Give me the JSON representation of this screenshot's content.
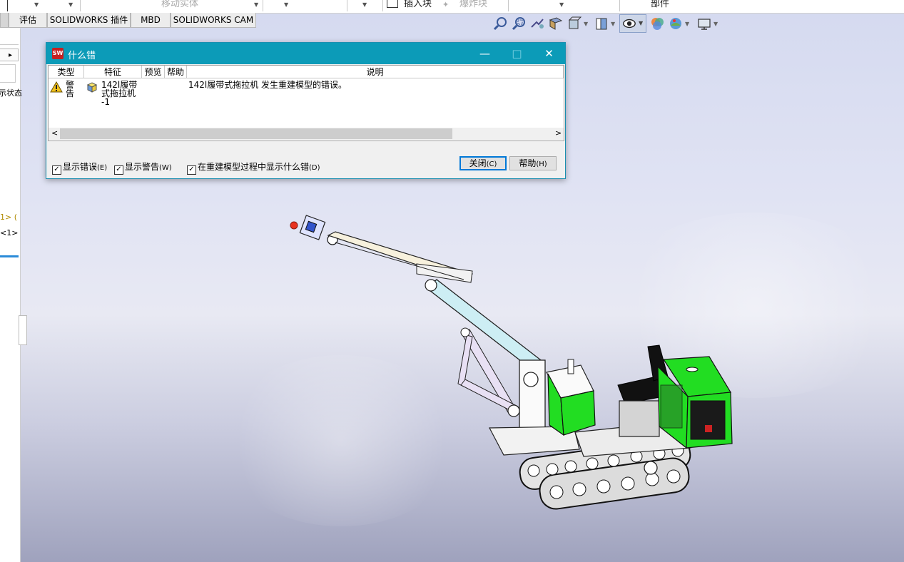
{
  "toolbar": {
    "move_body_label": "移动实体",
    "insert_block_label": "插入块",
    "explode_label": "爆炸块",
    "part_label": "部件"
  },
  "tabs": [
    "评估",
    "SOLIDWORKS 插件",
    "MBD",
    "SOLIDWORKS CAM"
  ],
  "left_panel": {
    "state_text": "示状态",
    "config_text_1": "1> (",
    "config_text_2": "<1>",
    "arrow": "▸"
  },
  "hud_icons": [
    "zoom-to-fit-icon",
    "zoom-area-icon",
    "previous-view-icon",
    "section-view-icon",
    "view-orientation-icon",
    "display-style-icon",
    "hide-show-icon",
    "edit-appearance-icon",
    "apply-scene-icon",
    "view-settings-icon"
  ],
  "dialog": {
    "title": "什么错",
    "minimize": "—",
    "maximize": "□",
    "close": "✕",
    "columns": [
      "类型",
      "特征",
      "预览",
      "帮助",
      "说明"
    ],
    "rows": [
      {
        "type": "警告",
        "feature": "142l履带式拖拉机-1",
        "feature_lines": [
          "142l履带",
          "式拖拉机",
          "-1"
        ],
        "description": "142l履带式拖拉机 发生重建模型的错误。"
      }
    ],
    "scroll_left": "<",
    "scroll_right": ">",
    "checkboxes": [
      {
        "label": "显示错误",
        "hotkey": "(E)",
        "checked": true
      },
      {
        "label": "显示警告",
        "hotkey": "(W)",
        "checked": true
      },
      {
        "label": "在重建模型过程中显示什么错",
        "hotkey": "(D)",
        "checked": true
      }
    ],
    "close_button": {
      "label": "关闭",
      "hotkey": "(C)"
    },
    "help_button": {
      "label": "帮助",
      "hotkey": "(H)"
    }
  },
  "colors": {
    "title_bar": "#0c9bb8",
    "model_green": "#22dd22",
    "accent": "#0078d7"
  }
}
